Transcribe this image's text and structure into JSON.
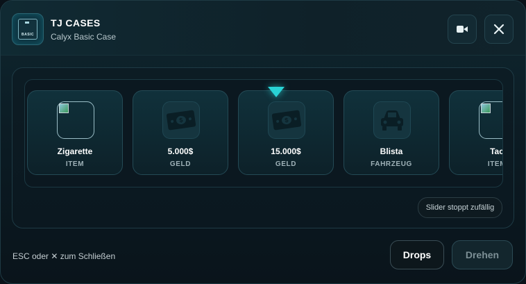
{
  "header": {
    "title": "TJ CASES",
    "subtitle": "Calyx Basic Case",
    "case_icon_label": "BASIC",
    "btn_a_icon": "video-camera-icon",
    "close_icon": "close-icon"
  },
  "slider": {
    "pointer_color": "#29d3d6",
    "items": [
      {
        "name": "Zigarette",
        "type": "ITEM",
        "icon": "broken-image-icon"
      },
      {
        "name": "5.000$",
        "type": "GELD",
        "icon": "money-icon"
      },
      {
        "name": "15.000$",
        "type": "GELD",
        "icon": "money-icon"
      },
      {
        "name": "Blista",
        "type": "FAHRZEUG",
        "icon": "car-icon"
      },
      {
        "name": "Tac",
        "type": "ITEM",
        "icon": "broken-image-icon"
      }
    ],
    "hint_button": "Slider stoppt zufällig"
  },
  "footer": {
    "hint": "ESC oder ✕ zum Schließen",
    "drops_label": "Drops",
    "spin_label": "Drehen"
  }
}
